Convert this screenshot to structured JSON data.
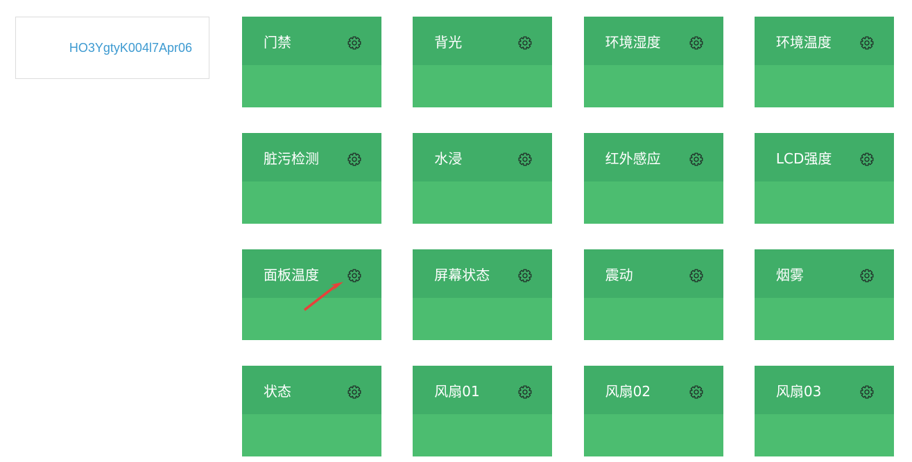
{
  "device": {
    "name": "HO3YgtyK004l7Apr06"
  },
  "tiles": [
    {
      "label": "门禁",
      "icon": "gear-icon"
    },
    {
      "label": "背光",
      "icon": "gear-icon"
    },
    {
      "label": "环境湿度",
      "icon": "gear-icon"
    },
    {
      "label": "环境温度",
      "icon": "gear-icon"
    },
    {
      "label": "脏污检测",
      "icon": "gear-icon"
    },
    {
      "label": "水浸",
      "icon": "gear-icon"
    },
    {
      "label": "红外感应",
      "icon": "gear-icon"
    },
    {
      "label": "LCD强度",
      "icon": "gear-icon"
    },
    {
      "label": "面板温度",
      "icon": "gear-icon"
    },
    {
      "label": "屏幕状态",
      "icon": "gear-icon"
    },
    {
      "label": "震动",
      "icon": "gear-icon"
    },
    {
      "label": "烟雾",
      "icon": "gear-icon"
    },
    {
      "label": "状态",
      "icon": "gear-icon"
    },
    {
      "label": "风扇01",
      "icon": "gear-icon"
    },
    {
      "label": "风扇02",
      "icon": "gear-icon"
    },
    {
      "label": "风扇03",
      "icon": "gear-icon"
    }
  ],
  "colors": {
    "tile_body": "#4cbd70",
    "tile_header": "#40ae68",
    "device_text": "#3d9ad1",
    "annotation_arrow": "#e8413a"
  }
}
